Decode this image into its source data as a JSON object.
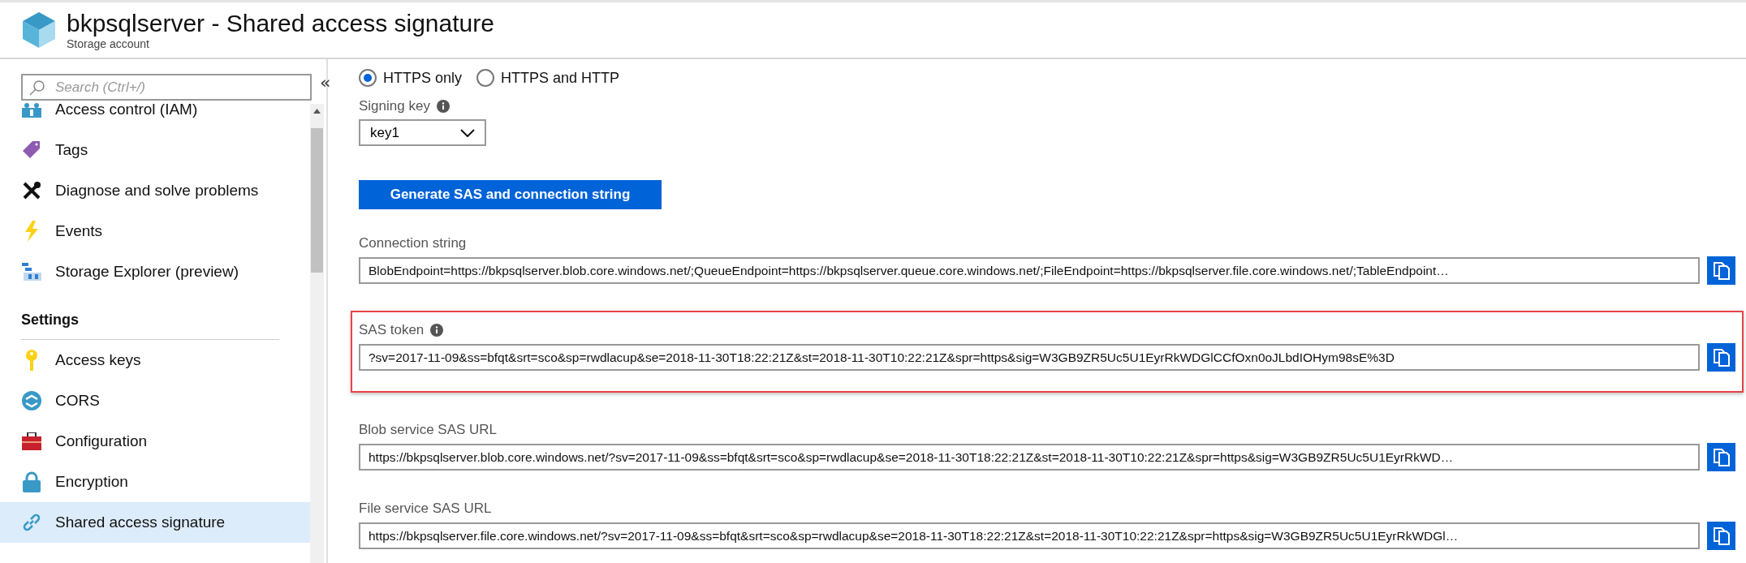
{
  "header": {
    "title": "bkpsqlserver - Shared access signature",
    "subtitle": "Storage account"
  },
  "sidebar": {
    "search": {
      "placeholder": "Search (Ctrl+/)"
    },
    "collapse": "«",
    "groups": [
      {
        "items": [
          {
            "label": "Access control (IAM)",
            "selected": false
          },
          {
            "label": "Tags",
            "selected": false
          },
          {
            "label": "Diagnose and solve problems",
            "selected": false
          },
          {
            "label": "Events",
            "selected": false
          },
          {
            "label": "Storage Explorer (preview)",
            "selected": false
          }
        ]
      },
      {
        "heading": "Settings",
        "items": [
          {
            "label": "Access keys",
            "selected": false
          },
          {
            "label": "CORS",
            "selected": false
          },
          {
            "label": "Configuration",
            "selected": false
          },
          {
            "label": "Encryption",
            "selected": false
          },
          {
            "label": "Shared access signature",
            "selected": true
          }
        ]
      }
    ]
  },
  "main": {
    "protocols": [
      {
        "label": "HTTPS only",
        "selected": true
      },
      {
        "label": "HTTPS and HTTP",
        "selected": false
      }
    ],
    "signing_key": {
      "label": "Signing key",
      "info": true,
      "value": "key1"
    },
    "generate_button": "Generate SAS and connection string",
    "outputs": [
      {
        "label": "Connection string",
        "info": false,
        "highlighted": false,
        "value": "BlobEndpoint=https://bkpsqlserver.blob.core.windows.net/;QueueEndpoint=https://bkpsqlserver.queue.core.windows.net/;FileEndpoint=https://bkpsqlserver.file.core.windows.net/;TableEndpoint…"
      },
      {
        "label": "SAS token",
        "info": true,
        "highlighted": true,
        "value": "?sv=2017-11-09&ss=bfqt&srt=sco&sp=rwdlacup&se=2018-11-30T18:22:21Z&st=2018-11-30T10:22:21Z&spr=https&sig=W3GB9ZR5Uc5U1EyrRkWDGlCCfOxn0oJLbdIOHym98sE%3D"
      },
      {
        "label": "Blob service SAS URL",
        "info": false,
        "highlighted": false,
        "value": "https://bkpsqlserver.blob.core.windows.net/?sv=2017-11-09&ss=bfqt&srt=sco&sp=rwdlacup&se=2018-11-30T18:22:21Z&st=2018-11-30T10:22:21Z&spr=https&sig=W3GB9ZR5Uc5U1EyrRkWD…"
      },
      {
        "label": "File service SAS URL",
        "info": false,
        "highlighted": false,
        "value": "https://bkpsqlserver.file.core.windows.net/?sv=2017-11-09&ss=bfqt&srt=sco&sp=rwdlacup&se=2018-11-30T18:22:21Z&st=2018-11-30T10:22:21Z&spr=https&sig=W3GB9ZR5Uc5U1EyrRkWDGl…"
      }
    ]
  }
}
